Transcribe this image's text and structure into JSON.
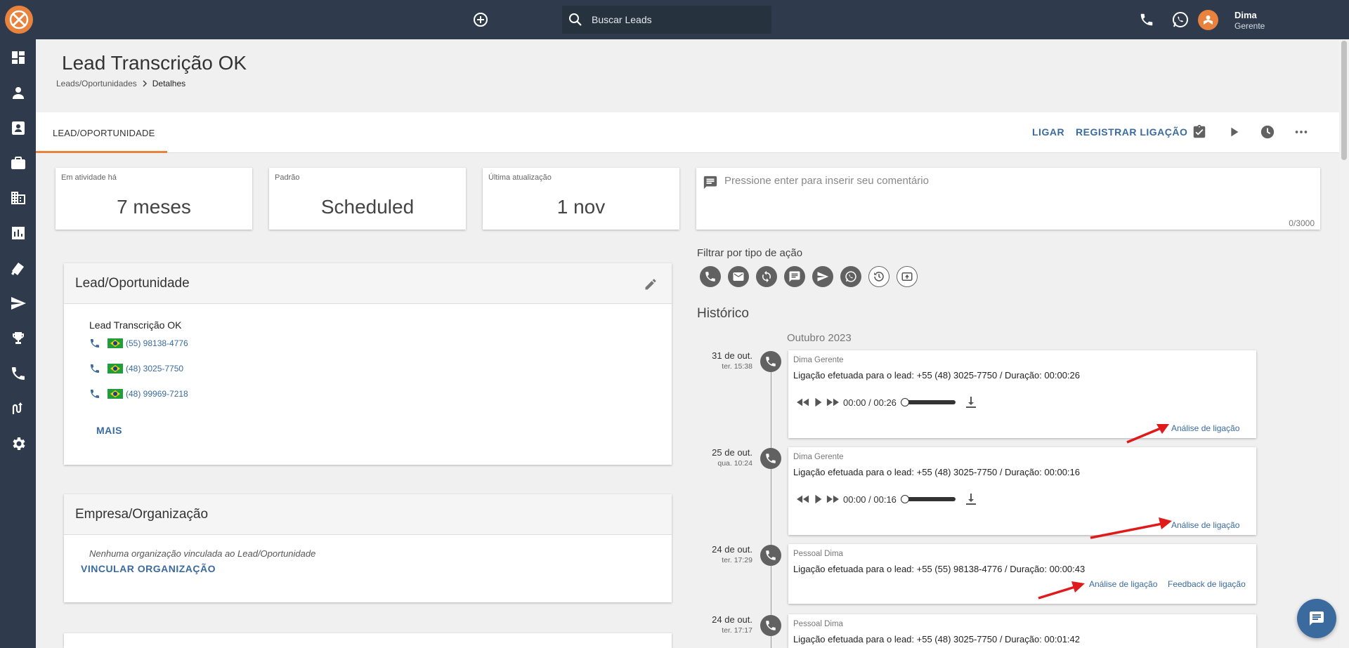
{
  "topbar": {
    "search_placeholder": "Buscar Leads",
    "user_name": "Dima",
    "user_role": "Gerente"
  },
  "header": {
    "title": "Lead Transcrição OK",
    "breadcrumb": [
      "Leads/Oportunidades",
      "Detalhes"
    ]
  },
  "tabs": {
    "active": "LEAD/OPORTUNIDADE",
    "ligar": "LIGAR",
    "registrar": "REGISTRAR LIGAÇÃO"
  },
  "stats": [
    {
      "label": "Em atividade há",
      "value": "7 meses"
    },
    {
      "label": "Padrão",
      "value": "Scheduled"
    },
    {
      "label": "Última atualização",
      "value": "1 nov"
    }
  ],
  "comment": {
    "placeholder": "Pressione enter para inserir seu comentário",
    "counter": "0/3000"
  },
  "filter": {
    "label": "Filtrar por tipo de ação"
  },
  "lead_panel": {
    "title": "Lead/Oportunidade",
    "name": "Lead Transcrição OK",
    "phones": [
      "(55) 98138-4776",
      "(48) 3025-7750",
      "(48) 99969-7218"
    ],
    "more": "MAIS"
  },
  "empresa_panel": {
    "title": "Empresa/Organização",
    "empty": "Nenhuma organização vinculada ao Lead/Oportunidade",
    "link": "VINCULAR ORGANIZAÇÃO"
  },
  "history": {
    "title": "Histórico",
    "month": "Outubro 2023",
    "entries": [
      {
        "date": "31 de out.",
        "day": "ter. 15:38",
        "author": "Dima Gerente",
        "text": "Ligação efetuada para o lead: +55 (48) 3025-7750 / Duração: 00:00:26",
        "time": "00:00 / 00:26",
        "analise": "Análise de ligação"
      },
      {
        "date": "25 de out.",
        "day": "qua. 10:24",
        "author": "Dima Gerente",
        "text": "Ligação efetuada para o lead: +55 (48) 3025-7750 / Duração: 00:00:16",
        "time": "00:00 / 00:16",
        "analise": "Análise de ligação"
      },
      {
        "date": "24 de out.",
        "day": "ter. 17:29",
        "author": "Pessoal Dima",
        "text": "Ligação efetuada para o lead: +55 (55) 98138-4776 / Duração: 00:00:43",
        "analise": "Análise de ligação",
        "feedback": "Feedback de ligação"
      },
      {
        "date": "24 de out.",
        "day": "ter. 17:17",
        "author": "Pessoal Dima",
        "text": "Ligação efetuada para o lead: +55 (48) 3025-7750 / Duração: 00:01:42"
      }
    ]
  },
  "colors": {
    "topbar": "#2f3b4c",
    "accent": "#e8823c",
    "link": "#3a6a9e",
    "annotation_arrow": "#e0191b"
  }
}
